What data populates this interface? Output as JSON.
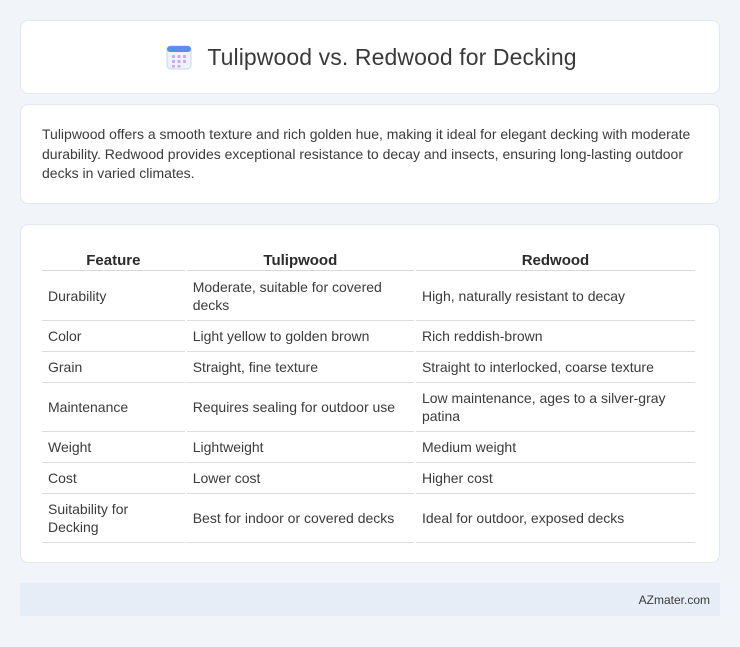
{
  "header": {
    "title": "Tulipwood vs. Redwood for Decking",
    "icon": "calendar-grid-icon",
    "icon_colors": {
      "top": "#5b8def",
      "grid": "#c9a6ef",
      "body": "#eef2fb"
    }
  },
  "summary": {
    "text": "Tulipwood offers a smooth texture and rich golden hue, making it ideal for elegant decking with moderate durability. Redwood provides exceptional resistance to decay and insects, ensuring long-lasting outdoor decks in varied climates."
  },
  "table": {
    "headers": [
      "Feature",
      "Tulipwood",
      "Redwood"
    ],
    "rows": [
      [
        "Durability",
        "Moderate, suitable for covered decks",
        "High, naturally resistant to decay"
      ],
      [
        "Color",
        "Light yellow to golden brown",
        "Rich reddish-brown"
      ],
      [
        "Grain",
        "Straight, fine texture",
        "Straight to interlocked, coarse texture"
      ],
      [
        "Maintenance",
        "Requires sealing for outdoor use",
        "Low maintenance, ages to a silver-gray patina"
      ],
      [
        "Weight",
        "Lightweight",
        "Medium weight"
      ],
      [
        "Cost",
        "Lower cost",
        "Higher cost"
      ],
      [
        "Suitability for Decking",
        "Best for indoor or covered decks",
        "Ideal for outdoor, exposed decks"
      ]
    ]
  },
  "footer": {
    "brand": "AZmater.com"
  }
}
